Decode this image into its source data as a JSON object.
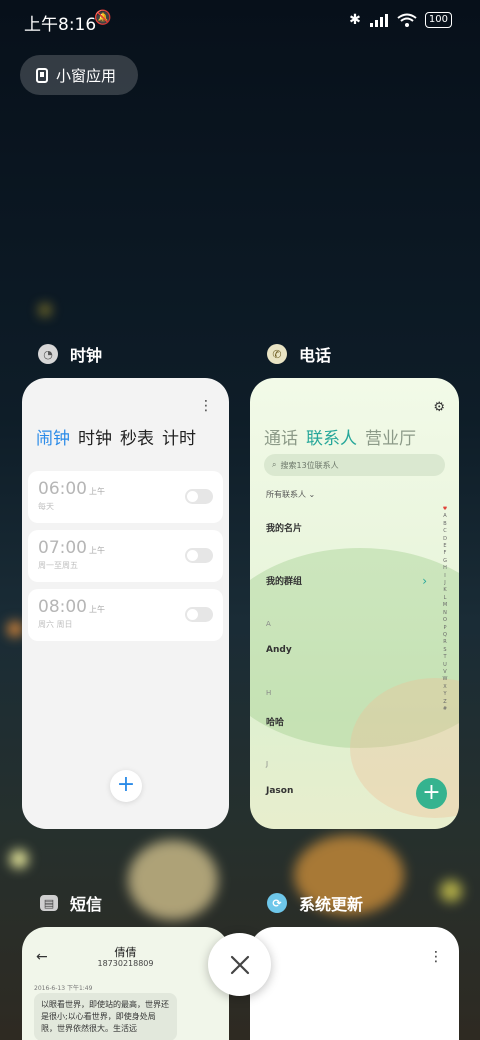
{
  "status_bar": {
    "time": "上午8:16",
    "battery": "100"
  },
  "small_window": {
    "label": "小窗应用"
  },
  "clock_app": {
    "name": "时钟",
    "tabs": [
      "闹钟",
      "时钟",
      "秒表",
      "计时"
    ],
    "alarms": [
      {
        "time": "06:00",
        "ampm": "上午",
        "repeat": "每天"
      },
      {
        "time": "07:00",
        "ampm": "上午",
        "repeat": "周一至周五"
      },
      {
        "time": "08:00",
        "ampm": "上午",
        "repeat": "周六 周日"
      }
    ],
    "add": "+"
  },
  "phone_app": {
    "name": "电话",
    "tabs": [
      "通话",
      "联系人",
      "营业厅"
    ],
    "search_placeholder": "搜索13位联系人",
    "all_contacts": "所有联系人",
    "my_card": "我的名片",
    "my_groups": "我的群组",
    "letters": [
      "A",
      "H",
      "J"
    ],
    "contacts": [
      "Andy",
      "哈哈",
      "Jason"
    ],
    "index": [
      "♥",
      "A",
      "B",
      "C",
      "D",
      "E",
      "F",
      "G",
      "H",
      "I",
      "J",
      "K",
      "L",
      "M",
      "N",
      "O",
      "P",
      "Q",
      "R",
      "S",
      "T",
      "U",
      "V",
      "W",
      "X",
      "Y",
      "Z",
      "#"
    ],
    "add": "+"
  },
  "sms_app": {
    "name": "短信",
    "contact_name": "倩倩",
    "contact_number": "18730218809",
    "date": "2016-6-13 下午1:49",
    "message": "以眼看世界，即使站的最高，世界还是很小;以心看世界，即使身处局限，世界依然很大。生活远"
  },
  "update_app": {
    "name": "系统更新"
  }
}
